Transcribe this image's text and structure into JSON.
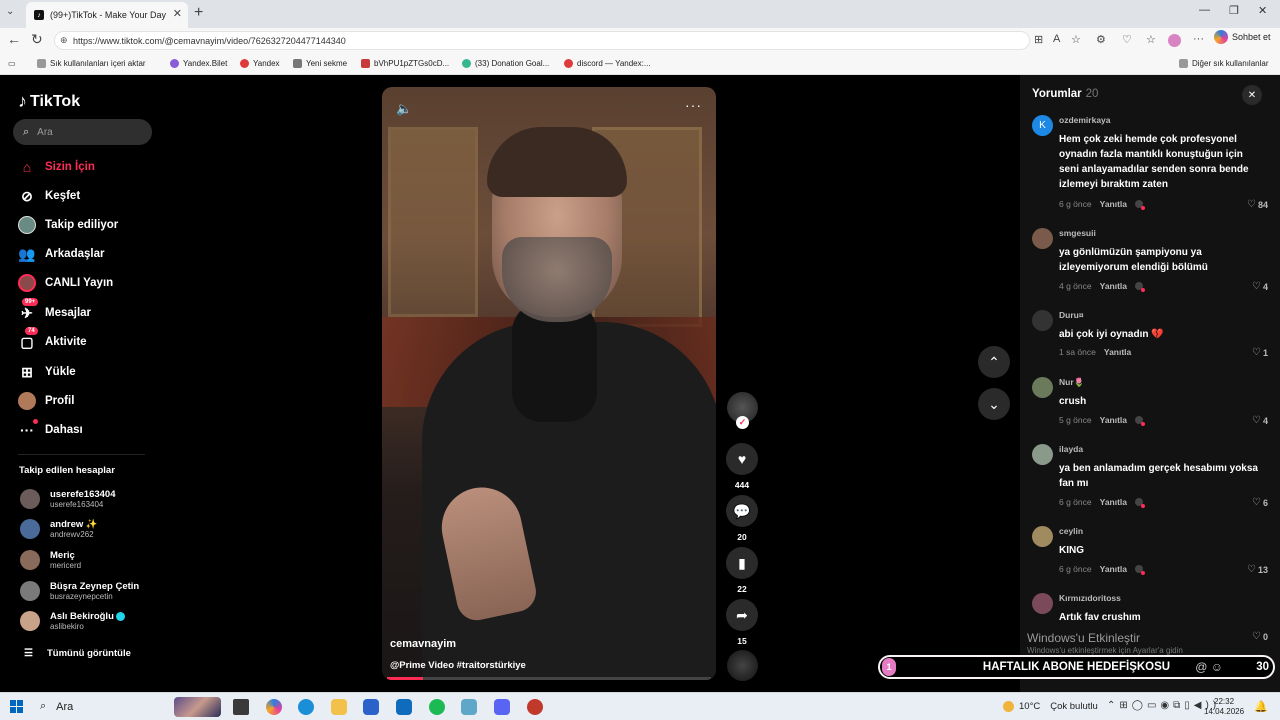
{
  "browser": {
    "tab_title": "(99+)TikTok - Make Your Day",
    "url": "https://www.tiktok.com/@cemavnayim/video/7626327204477144340",
    "chat_label": "Sohbet et",
    "bookmarks": [
      "Sık kullanılanları içeri aktar",
      "Yandex.Bilet",
      "Yandex",
      "Yeni sekme",
      "bVhPU1pZTGs0cD...",
      "(33) Donation Goal...",
      "discord — Yandex:..."
    ],
    "other_bookmarks": "Diğer sık kullanılanlar"
  },
  "sidebar": {
    "logo": "TikTok",
    "search_placeholder": "Ara",
    "nav": [
      {
        "label": "Sizin İçin",
        "icon": "home-icon",
        "active": true
      },
      {
        "label": "Keşfet",
        "icon": "compass-icon"
      },
      {
        "label": "Takip ediliyor",
        "icon": "following-avatar-icon"
      },
      {
        "label": "Arkadaşlar",
        "icon": "friends-icon"
      },
      {
        "label": "CANLI Yayın",
        "icon": "live-icon"
      },
      {
        "label": "Mesajlar",
        "icon": "message-icon",
        "badge": "99+"
      },
      {
        "label": "Aktivite",
        "icon": "activity-icon",
        "badge": "74"
      },
      {
        "label": "Yükle",
        "icon": "upload-icon"
      },
      {
        "label": "Profil",
        "icon": "profile-avatar-icon"
      },
      {
        "label": "Dahası",
        "icon": "more-icon"
      }
    ],
    "following_title": "Takip edilen hesaplar",
    "following": [
      {
        "name": "userefe163404",
        "handle": "userefe163404"
      },
      {
        "name": "andrew ✨",
        "handle": "andrewv262"
      },
      {
        "name": "Meriç",
        "handle": "mericerd"
      },
      {
        "name": "Büşra Zeynep Çetin",
        "handle": "busrazeynepcetin"
      },
      {
        "name": "Aslı Bekiroğlu",
        "handle": "aslibekiro",
        "verified": true
      }
    ],
    "see_all": "Tümünü görüntüle"
  },
  "video": {
    "author": "cemavnayim",
    "caption": "@Prime Video #traitorstürkiye",
    "progress": 0.11,
    "likes": "444",
    "comments": "20",
    "saves": "22",
    "shares": "15"
  },
  "comments_panel": {
    "title": "Yorumlar",
    "count": "20",
    "reply_label": "Yanıtla",
    "items": [
      {
        "user": "ozdemirkaya",
        "avatar": "K",
        "text": "Hem çok zeki hemde çok profesyonel oynadın fazla mantıklı konuştuğun için seni anlayamadılar senden sonra bende izlemeyi bıraktım zaten",
        "time": "6 g önce",
        "likes": "84"
      },
      {
        "user": "smgesuii",
        "text": "ya gönlümüzün şampiyonu ya izleyemiyorum elendiği bölümü",
        "time": "4 g önce",
        "likes": "4"
      },
      {
        "user": "Duru¤",
        "text": "abi çok iyi oynadın 💔",
        "time": "1 sa önce",
        "likes": "1"
      },
      {
        "user": "Nur🌷",
        "text": "crush",
        "time": "5 g önce",
        "likes": "4"
      },
      {
        "user": "ilayda",
        "text": "ya ben anlamadım gerçek hesabımı yoksa fan mı",
        "time": "6 g önce",
        "likes": "6"
      },
      {
        "user": "ceylin",
        "text": "KING",
        "time": "6 g önce",
        "likes": "13"
      },
      {
        "user": "Kırmızıdoritoss",
        "text": "Artık fav crushım",
        "time": "",
        "likes": "0"
      }
    ]
  },
  "overlay": {
    "watermark": "Windows'u Etkinleştir",
    "watermark_sub": "Windows'u etkinleştirmek için Ayarlar'a gidin",
    "donation_label": "HAFTALIK ABONE HEDEFİŞKOSU",
    "donation_left": "1",
    "donation_right": "30"
  },
  "taskbar": {
    "search": "Ara",
    "temperature": "10°C",
    "weather": "Çok bulutlu",
    "time": "22:32",
    "date": "14.04.2026"
  }
}
